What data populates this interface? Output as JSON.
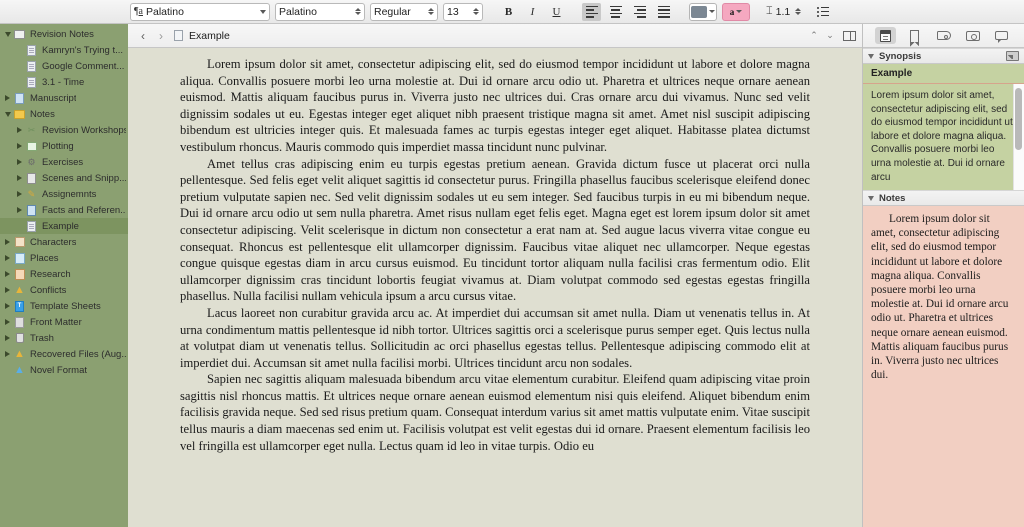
{
  "format_toolbar": {
    "paragraph_style": "Palatino",
    "font_family": "Palatino",
    "font_face": "Regular",
    "font_size": "13",
    "bold_label": "B",
    "italic_label": "I",
    "underline_label": "U",
    "line_height": "1.1",
    "text_color": "#7b8793",
    "highlight_color": "#f5a8c0",
    "highlight_label": "a"
  },
  "header": {
    "back_label": "‹",
    "forward_label": "›",
    "title": "Example"
  },
  "sidebar": {
    "background": "#8ba071",
    "selected_background": "#7d9460",
    "items": [
      {
        "label": "Revision Notes",
        "indent": 0,
        "disclosure": "open",
        "icon": "folder-white-icon",
        "selected": false
      },
      {
        "label": "Kamryn's Trying t...",
        "indent": 1,
        "disclosure": "none",
        "icon": "document-icon",
        "selected": false
      },
      {
        "label": "Google Comment...",
        "indent": 1,
        "disclosure": "none",
        "icon": "document-icon",
        "selected": false
      },
      {
        "label": "3.1 - Time",
        "indent": 1,
        "disclosure": "none",
        "icon": "document-icon",
        "selected": false
      },
      {
        "label": "Manuscript",
        "indent": 0,
        "disclosure": "closed",
        "icon": "manuscript-icon",
        "selected": false
      },
      {
        "label": "Notes",
        "indent": 0,
        "disclosure": "open",
        "icon": "folder-yellow-icon",
        "selected": false
      },
      {
        "label": "Revision Workshops",
        "indent": 1,
        "disclosure": "closed",
        "icon": "scissors-icon",
        "selected": false
      },
      {
        "label": "Plotting",
        "indent": 1,
        "disclosure": "closed",
        "icon": "chart-icon",
        "selected": false
      },
      {
        "label": "Exercises",
        "indent": 1,
        "disclosure": "closed",
        "icon": "gear-icon",
        "selected": false
      },
      {
        "label": "Scenes and Snipp...",
        "indent": 1,
        "disclosure": "closed",
        "icon": "grid-icon",
        "selected": false
      },
      {
        "label": "Assignemnts",
        "indent": 1,
        "disclosure": "closed",
        "icon": "pencil-icon",
        "selected": false
      },
      {
        "label": "Facts and Referen...",
        "indent": 1,
        "disclosure": "closed",
        "icon": "book-icon",
        "selected": false
      },
      {
        "label": "Example",
        "indent": 1,
        "disclosure": "none",
        "icon": "document-icon",
        "selected": true
      },
      {
        "label": "Characters",
        "indent": 0,
        "disclosure": "closed",
        "icon": "characters-icon",
        "selected": false
      },
      {
        "label": "Places",
        "indent": 0,
        "disclosure": "closed",
        "icon": "places-icon",
        "selected": false
      },
      {
        "label": "Research",
        "indent": 0,
        "disclosure": "closed",
        "icon": "research-icon",
        "selected": false
      },
      {
        "label": "Conflicts",
        "indent": 0,
        "disclosure": "closed",
        "icon": "warning-icon",
        "selected": false
      },
      {
        "label": "Template Sheets",
        "indent": 0,
        "disclosure": "closed",
        "icon": "template-icon",
        "selected": false
      },
      {
        "label": "Front Matter",
        "indent": 0,
        "disclosure": "closed",
        "icon": "front-matter-icon",
        "selected": false
      },
      {
        "label": "Trash",
        "indent": 0,
        "disclosure": "closed",
        "icon": "trash-icon",
        "selected": false
      },
      {
        "label": "Recovered Files (Aug...",
        "indent": 0,
        "disclosure": "closed",
        "icon": "warning-icon",
        "selected": false
      },
      {
        "label": "Novel Format",
        "indent": 0,
        "disclosure": "none",
        "icon": "warning-blue-icon",
        "selected": false
      }
    ]
  },
  "editor": {
    "background": "#dfdfd1",
    "paragraphs": [
      "Lorem ipsum dolor sit amet, consectetur adipiscing elit, sed do eiusmod tempor incididunt ut labore et dolore magna aliqua. Convallis posuere morbi leo urna molestie at. Dui id ornare arcu odio ut. Pharetra et ultrices neque ornare aenean euismod. Mattis aliquam faucibus purus in. Viverra justo nec ultrices dui. Cras ornare arcu dui vivamus. Nunc sed velit dignissim sodales ut eu. Egestas integer eget aliquet nibh praesent tristique magna sit amet. Amet nisl suscipit adipiscing bibendum est ultricies integer quis. Et malesuada fames ac turpis egestas integer eget aliquet. Habitasse platea dictumst vestibulum rhoncus. Mauris commodo quis imperdiet massa tincidunt nunc pulvinar.",
      "Amet tellus cras adipiscing enim eu turpis egestas pretium aenean. Gravida dictum fusce ut placerat orci nulla pellentesque. Sed felis eget velit aliquet sagittis id consectetur purus. Fringilla phasellus faucibus scelerisque eleifend donec pretium vulputate sapien nec. Sed velit dignissim sodales ut eu sem integer. Sed faucibus turpis in eu mi bibendum neque. Dui id ornare arcu odio ut sem nulla pharetra. Amet risus nullam eget felis eget. Magna eget est lorem ipsum dolor sit amet consectetur adipiscing. Velit scelerisque in dictum non consectetur a erat nam at. Sed augue lacus viverra vitae congue eu consequat. Rhoncus est pellentesque elit ullamcorper dignissim. Faucibus vitae aliquet nec ullamcorper. Neque egestas congue quisque egestas diam in arcu cursus euismod. Eu tincidunt tortor aliquam nulla facilisi cras fermentum odio. Elit ullamcorper dignissim cras tincidunt lobortis feugiat vivamus at. Diam volutpat commodo sed egestas egestas fringilla phasellus. Nulla facilisi nullam vehicula ipsum a arcu cursus vitae.",
      "Lacus laoreet non curabitur gravida arcu ac. At imperdiet dui accumsan sit amet nulla. Diam ut venenatis tellus in. At urna condimentum mattis pellentesque id nibh tortor. Ultrices sagittis orci a scelerisque purus semper eget. Quis lectus nulla at volutpat diam ut venenatis tellus. Sollicitudin ac orci phasellus egestas tellus. Pellentesque adipiscing commodo elit at imperdiet dui. Accumsan sit amet nulla facilisi morbi. Ultrices tincidunt arcu non sodales.",
      "Sapien nec sagittis aliquam malesuada bibendum arcu vitae elementum curabitur. Eleifend quam adipiscing vitae proin sagittis nisl rhoncus mattis. Et ultrices neque ornare aenean euismod elementum nisi quis eleifend. Aliquet bibendum enim facilisis gravida neque. Sed sed risus pretium quam. Consequat interdum varius sit amet mattis vulputate enim. Vitae suscipit tellus mauris a diam maecenas sed enim ut. Facilisis volutpat est velit egestas dui id ornare. Praesent elementum facilisis leo vel fringilla est ullamcorper eget nulla. Lectus quam id leo in vitae turpis. Odio eu"
    ]
  },
  "inspector": {
    "synopsis": {
      "panel_title": "Synopsis",
      "card_title": "Example",
      "background": "#c5d2a2",
      "text": "Lorem ipsum dolor sit amet, consectetur adipiscing elit, sed do eiusmod tempor incididunt ut labore et dolore magna aliqua. Convallis posuere morbi leo urna molestie at. Dui id ornare arcu"
    },
    "notes": {
      "panel_title": "Notes",
      "background": "#f2cfc2",
      "text": "Lorem ipsum dolor sit amet, consectetur adipiscing elit, sed do eiusmod tempor incididunt ut labore et dolore magna aliqua. Convallis posuere morbi leo urna molestie at. Dui id ornare arcu odio ut. Pharetra et ultrices neque ornare aenean euismod. Mattis aliquam faucibus purus in. Viverra justo nec ultrices dui."
    }
  }
}
